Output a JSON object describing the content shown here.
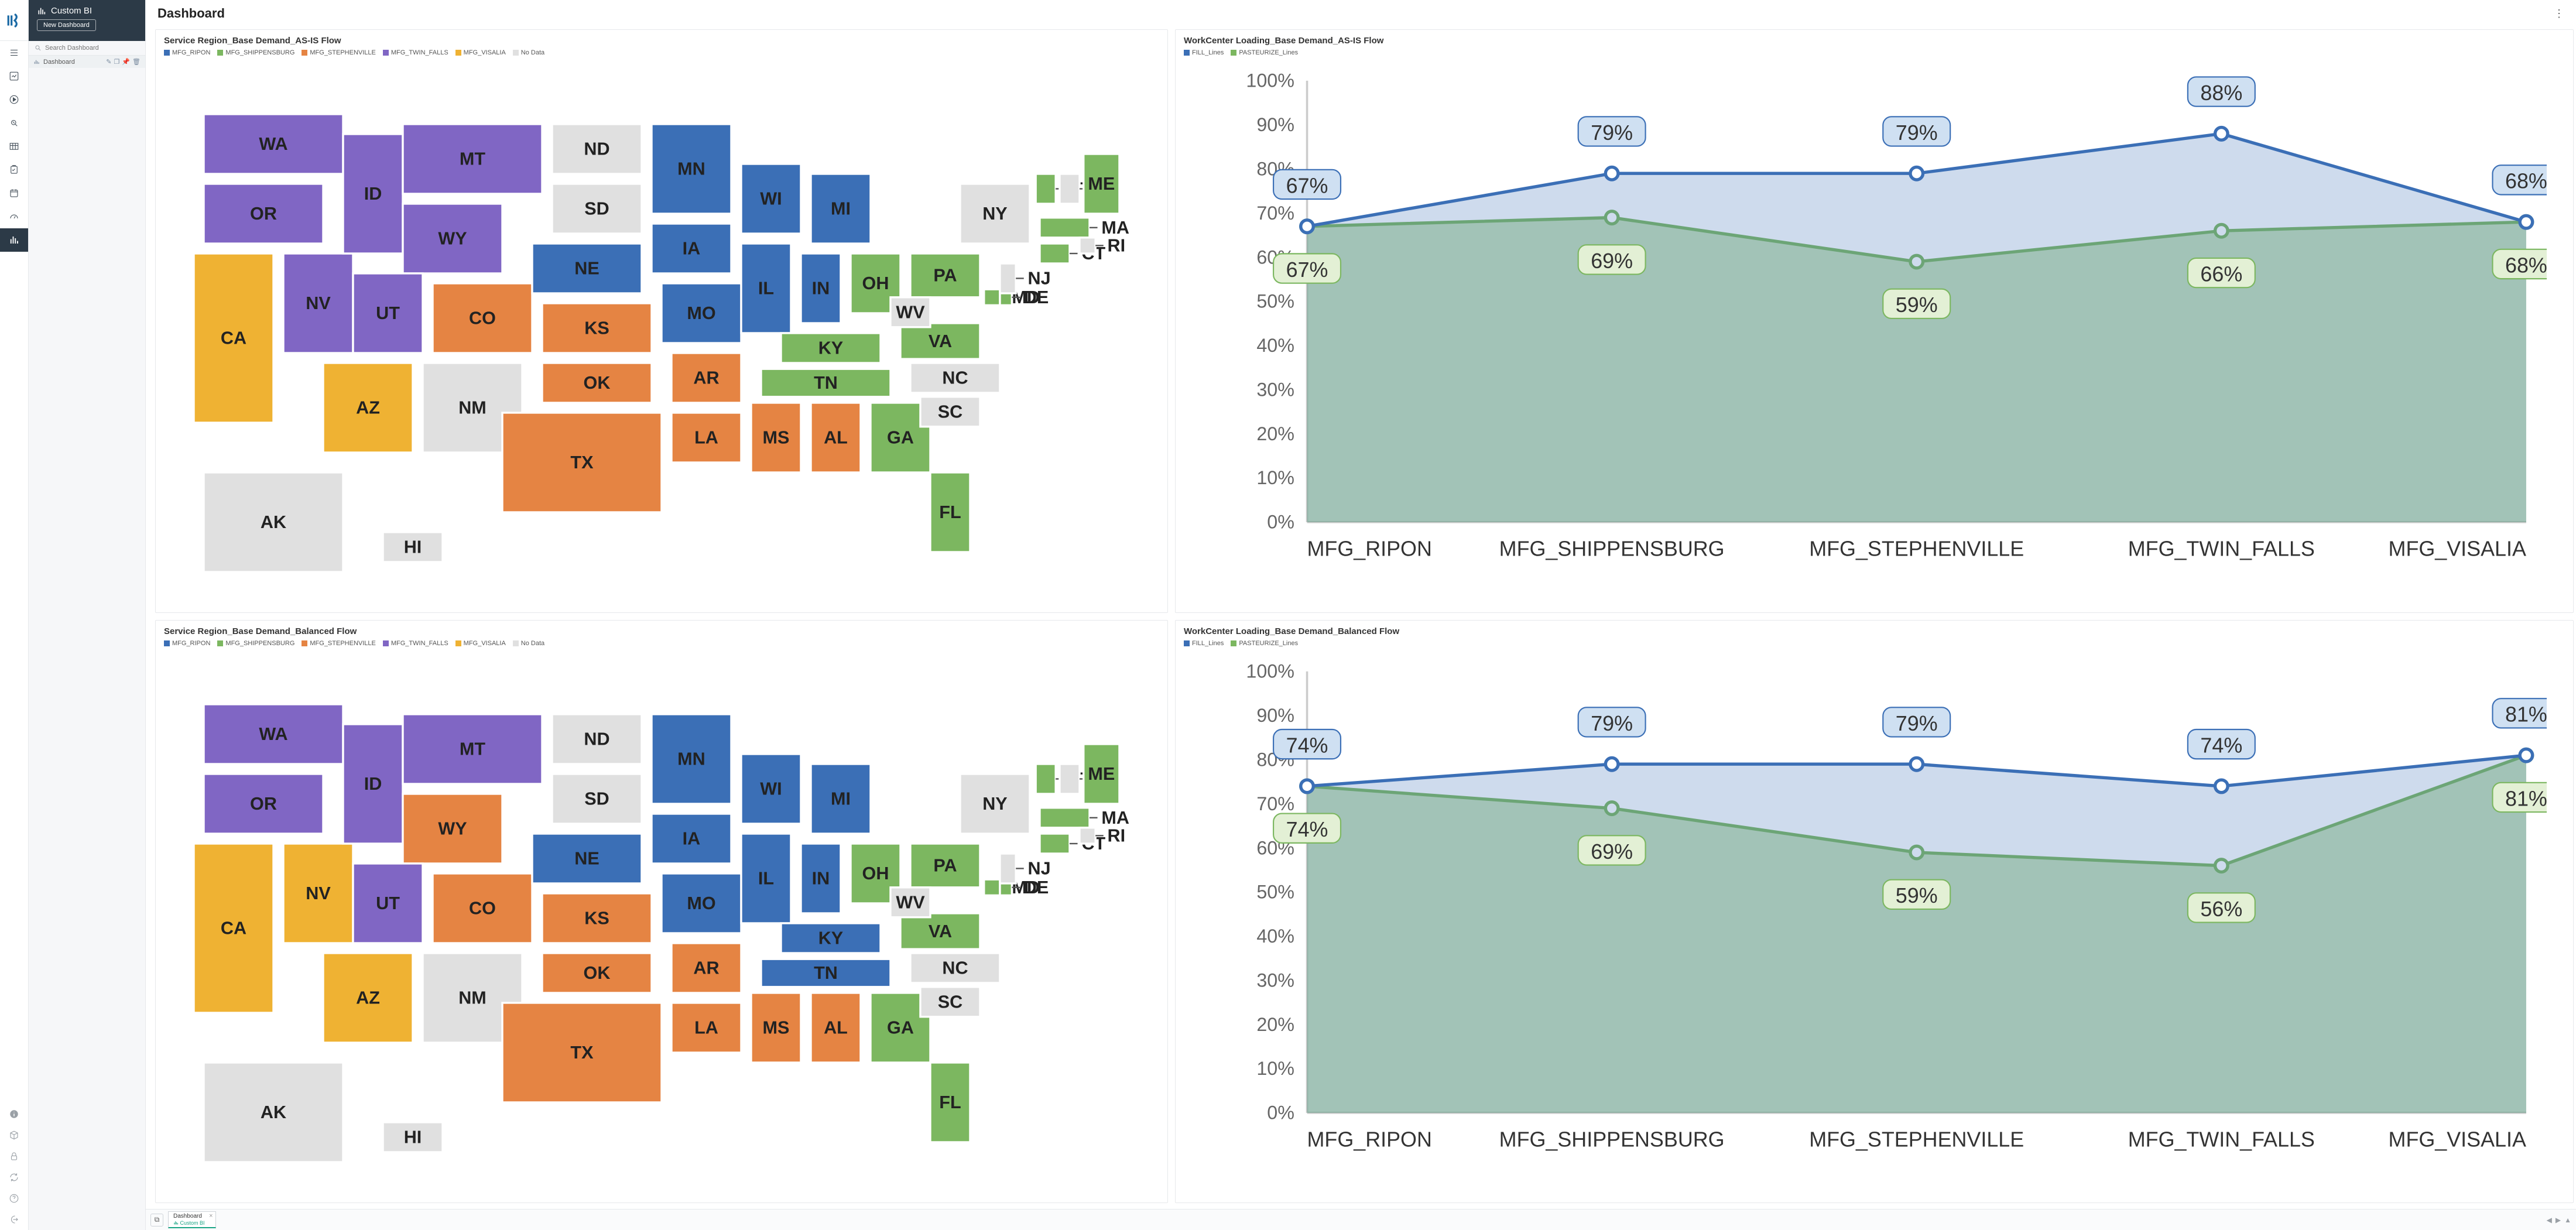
{
  "sidebar": {
    "app_name": "Custom BI",
    "new_dashboard_label": "New Dashboard",
    "search_placeholder": "Search Dashboard",
    "tree": [
      {
        "label": "Dashboard"
      }
    ]
  },
  "page": {
    "title": "Dashboard"
  },
  "tabstrip": {
    "tabs": [
      {
        "title": "Dashboard",
        "subtitle": "Custom BI"
      }
    ]
  },
  "legend_colors": {
    "MFG_RIPON": "#3b6fb6",
    "MFG_SHIPPENSBURG": "#7cb760",
    "MFG_STEPHENVILLE": "#e58443",
    "MFG_TWIN_FALLS": "#8066c4",
    "MFG_VISALIA": "#efb233",
    "No Data": "#e0e0e0",
    "FILL_Lines": "#3b6fb6",
    "PASTEURIZE_Lines": "#7cb760"
  },
  "panels": {
    "map_asis": {
      "title": "Service Region_Base Demand_AS-IS Flow",
      "legend": [
        "MFG_RIPON",
        "MFG_SHIPPENSBURG",
        "MFG_STEPHENVILLE",
        "MFG_TWIN_FALLS",
        "MFG_VISALIA",
        "No Data"
      ]
    },
    "map_balanced": {
      "title": "Service Region_Base Demand_Balanced Flow",
      "legend": [
        "MFG_RIPON",
        "MFG_SHIPPENSBURG",
        "MFG_STEPHENVILLE",
        "MFG_TWIN_FALLS",
        "MFG_VISALIA",
        "No Data"
      ]
    },
    "load_asis": {
      "title": "WorkCenter Loading_Base Demand_AS-IS Flow",
      "legend": [
        "FILL_Lines",
        "PASTEURIZE_Lines"
      ]
    },
    "load_balanced": {
      "title": "WorkCenter Loading_Base Demand_Balanced Flow",
      "legend": [
        "FILL_Lines",
        "PASTEURIZE_Lines"
      ]
    }
  },
  "chart_data": [
    {
      "id": "map_asis",
      "type": "map",
      "title": "Service Region_Base Demand_AS-IS Flow",
      "categories": [
        "MFG_RIPON",
        "MFG_SHIPPENSBURG",
        "MFG_STEPHENVILLE",
        "MFG_TWIN_FALLS",
        "MFG_VISALIA",
        "No Data"
      ],
      "states": {
        "WA": "MFG_TWIN_FALLS",
        "OR": "MFG_TWIN_FALLS",
        "ID": "MFG_TWIN_FALLS",
        "MT": "MFG_TWIN_FALLS",
        "WY": "MFG_TWIN_FALLS",
        "UT": "MFG_TWIN_FALLS",
        "NV": "MFG_TWIN_FALLS",
        "CA": "MFG_VISALIA",
        "AZ": "MFG_VISALIA",
        "CO": "MFG_STEPHENVILLE",
        "KS": "MFG_STEPHENVILLE",
        "OK": "MFG_STEPHENVILLE",
        "TX": "MFG_STEPHENVILLE",
        "AR": "MFG_STEPHENVILLE",
        "LA": "MFG_STEPHENVILLE",
        "MS": "MFG_STEPHENVILLE",
        "AL": "MFG_STEPHENVILLE",
        "NE": "MFG_RIPON",
        "IA": "MFG_RIPON",
        "MN": "MFG_RIPON",
        "WI": "MFG_RIPON",
        "MI": "MFG_RIPON",
        "IL": "MFG_RIPON",
        "IN": "MFG_RIPON",
        "MO": "MFG_RIPON",
        "OH": "MFG_SHIPPENSBURG",
        "PA": "MFG_SHIPPENSBURG",
        "KY": "MFG_SHIPPENSBURG",
        "TN": "MFG_SHIPPENSBURG",
        "VA": "MFG_SHIPPENSBURG",
        "MD": "MFG_SHIPPENSBURG",
        "DE": "MFG_SHIPPENSBURG",
        "GA": "MFG_SHIPPENSBURG",
        "FL": "MFG_SHIPPENSBURG",
        "CT": "MFG_SHIPPENSBURG",
        "MA": "MFG_SHIPPENSBURG",
        "ME": "MFG_SHIPPENSBURG",
        "VT": "MFG_SHIPPENSBURG",
        "ND": "No Data",
        "SD": "No Data",
        "NM": "No Data",
        "WV": "No Data",
        "NY": "No Data",
        "NC": "No Data",
        "SC": "No Data",
        "NH": "No Data",
        "NJ": "No Data",
        "RI": "No Data",
        "AK": "No Data",
        "HI": "No Data"
      }
    },
    {
      "id": "map_balanced",
      "type": "map",
      "title": "Service Region_Base Demand_Balanced Flow",
      "categories": [
        "MFG_RIPON",
        "MFG_SHIPPENSBURG",
        "MFG_STEPHENVILLE",
        "MFG_TWIN_FALLS",
        "MFG_VISALIA",
        "No Data"
      ],
      "states": {
        "WA": "MFG_TWIN_FALLS",
        "OR": "MFG_TWIN_FALLS",
        "ID": "MFG_TWIN_FALLS",
        "MT": "MFG_TWIN_FALLS",
        "UT": "MFG_TWIN_FALLS",
        "WY": "MFG_STEPHENVILLE",
        "CO": "MFG_STEPHENVILLE",
        "KS": "MFG_STEPHENVILLE",
        "OK": "MFG_STEPHENVILLE",
        "TX": "MFG_STEPHENVILLE",
        "AR": "MFG_STEPHENVILLE",
        "LA": "MFG_STEPHENVILLE",
        "MS": "MFG_STEPHENVILLE",
        "AL": "MFG_STEPHENVILLE",
        "NV": "MFG_VISALIA",
        "CA": "MFG_VISALIA",
        "AZ": "MFG_VISALIA",
        "NE": "MFG_RIPON",
        "IA": "MFG_RIPON",
        "MN": "MFG_RIPON",
        "WI": "MFG_RIPON",
        "MI": "MFG_RIPON",
        "IL": "MFG_RIPON",
        "IN": "MFG_RIPON",
        "MO": "MFG_RIPON",
        "KY": "MFG_RIPON",
        "TN": "MFG_RIPON",
        "OH": "MFG_SHIPPENSBURG",
        "PA": "MFG_SHIPPENSBURG",
        "VA": "MFG_SHIPPENSBURG",
        "MD": "MFG_SHIPPENSBURG",
        "DE": "MFG_SHIPPENSBURG",
        "GA": "MFG_SHIPPENSBURG",
        "FL": "MFG_SHIPPENSBURG",
        "CT": "MFG_SHIPPENSBURG",
        "MA": "MFG_SHIPPENSBURG",
        "ME": "MFG_SHIPPENSBURG",
        "VT": "MFG_SHIPPENSBURG",
        "ND": "No Data",
        "SD": "No Data",
        "NM": "No Data",
        "WV": "No Data",
        "NY": "No Data",
        "NC": "No Data",
        "SC": "No Data",
        "NH": "No Data",
        "NJ": "No Data",
        "RI": "No Data",
        "AK": "No Data",
        "HI": "No Data"
      }
    },
    {
      "id": "load_asis",
      "type": "area",
      "title": "WorkCenter Loading_Base Demand_AS-IS Flow",
      "categories": [
        "MFG_RIPON",
        "MFG_SHIPPENSBURG",
        "MFG_STEPHENVILLE",
        "MFG_TWIN_FALLS",
        "MFG_VISALIA"
      ],
      "ylim": [
        0,
        100
      ],
      "yticks": [
        0,
        10,
        20,
        30,
        40,
        50,
        60,
        70,
        80,
        90,
        100
      ],
      "series": [
        {
          "name": "FILL_Lines",
          "values": [
            67,
            79,
            79,
            88,
            68
          ]
        },
        {
          "name": "PASTEURIZE_Lines",
          "values": [
            67,
            69,
            59,
            66,
            68
          ]
        }
      ]
    },
    {
      "id": "load_balanced",
      "type": "area",
      "title": "WorkCenter Loading_Base Demand_Balanced Flow",
      "categories": [
        "MFG_RIPON",
        "MFG_SHIPPENSBURG",
        "MFG_STEPHENVILLE",
        "MFG_TWIN_FALLS",
        "MFG_VISALIA"
      ],
      "ylim": [
        0,
        100
      ],
      "yticks": [
        0,
        10,
        20,
        30,
        40,
        50,
        60,
        70,
        80,
        90,
        100
      ],
      "series": [
        {
          "name": "FILL_Lines",
          "values": [
            74,
            79,
            79,
            74,
            81
          ]
        },
        {
          "name": "PASTEURIZE_Lines",
          "values": [
            74,
            69,
            59,
            56,
            81
          ]
        }
      ]
    }
  ],
  "state_geom": {
    "WA": [
      20,
      20,
      70,
      30
    ],
    "OR": [
      20,
      55,
      60,
      30
    ],
    "CA": [
      15,
      90,
      40,
      85
    ],
    "NV": [
      60,
      90,
      35,
      50
    ],
    "ID": [
      90,
      30,
      30,
      60
    ],
    "MT": [
      120,
      25,
      70,
      35
    ],
    "WY": [
      120,
      65,
      50,
      35
    ],
    "UT": [
      95,
      100,
      35,
      40
    ],
    "AZ": [
      80,
      145,
      45,
      45
    ],
    "CO": [
      135,
      105,
      50,
      35
    ],
    "NM": [
      130,
      145,
      50,
      45
    ],
    "ND": [
      195,
      25,
      45,
      25
    ],
    "SD": [
      195,
      55,
      45,
      25
    ],
    "NE": [
      185,
      85,
      55,
      25
    ],
    "KS": [
      190,
      115,
      55,
      25
    ],
    "OK": [
      190,
      145,
      55,
      20
    ],
    "TX": [
      170,
      170,
      80,
      50
    ],
    "MN": [
      245,
      25,
      40,
      45
    ],
    "IA": [
      245,
      75,
      40,
      25
    ],
    "MO": [
      250,
      105,
      40,
      30
    ],
    "AR": [
      255,
      140,
      35,
      25
    ],
    "LA": [
      255,
      170,
      35,
      25
    ],
    "WI": [
      290,
      45,
      30,
      35
    ],
    "IL": [
      290,
      85,
      25,
      45
    ],
    "MI": [
      325,
      50,
      30,
      35
    ],
    "IN": [
      320,
      90,
      20,
      35
    ],
    "OH": [
      345,
      90,
      25,
      30
    ],
    "KY": [
      310,
      130,
      50,
      15
    ],
    "TN": [
      300,
      148,
      65,
      14
    ],
    "MS": [
      295,
      165,
      25,
      35
    ],
    "AL": [
      325,
      165,
      25,
      35
    ],
    "GA": [
      355,
      165,
      30,
      35
    ],
    "FL": [
      385,
      200,
      20,
      40
    ],
    "PA": [
      375,
      90,
      35,
      22
    ],
    "VA": [
      370,
      125,
      40,
      18
    ],
    "WV": [
      365,
      112,
      20,
      15
    ],
    "MD": [
      412,
      108,
      8,
      8
    ],
    "DE": [
      420,
      108,
      6,
      8
    ],
    "NC": [
      375,
      145,
      45,
      15
    ],
    "SC": [
      380,
      162,
      30,
      15
    ],
    "NY": [
      400,
      55,
      35,
      30
    ],
    "VT": [
      438,
      50,
      10,
      15
    ],
    "NH": [
      450,
      50,
      10,
      15
    ],
    "ME": [
      462,
      40,
      18,
      30
    ],
    "MA": [
      440,
      72,
      25,
      10
    ],
    "CT": [
      440,
      85,
      15,
      10
    ],
    "NJ": [
      420,
      95,
      8,
      15
    ],
    "RI": [
      460,
      82,
      8,
      8
    ],
    "AK": [
      20,
      200,
      70,
      50
    ],
    "HI": [
      110,
      230,
      30,
      15
    ]
  }
}
